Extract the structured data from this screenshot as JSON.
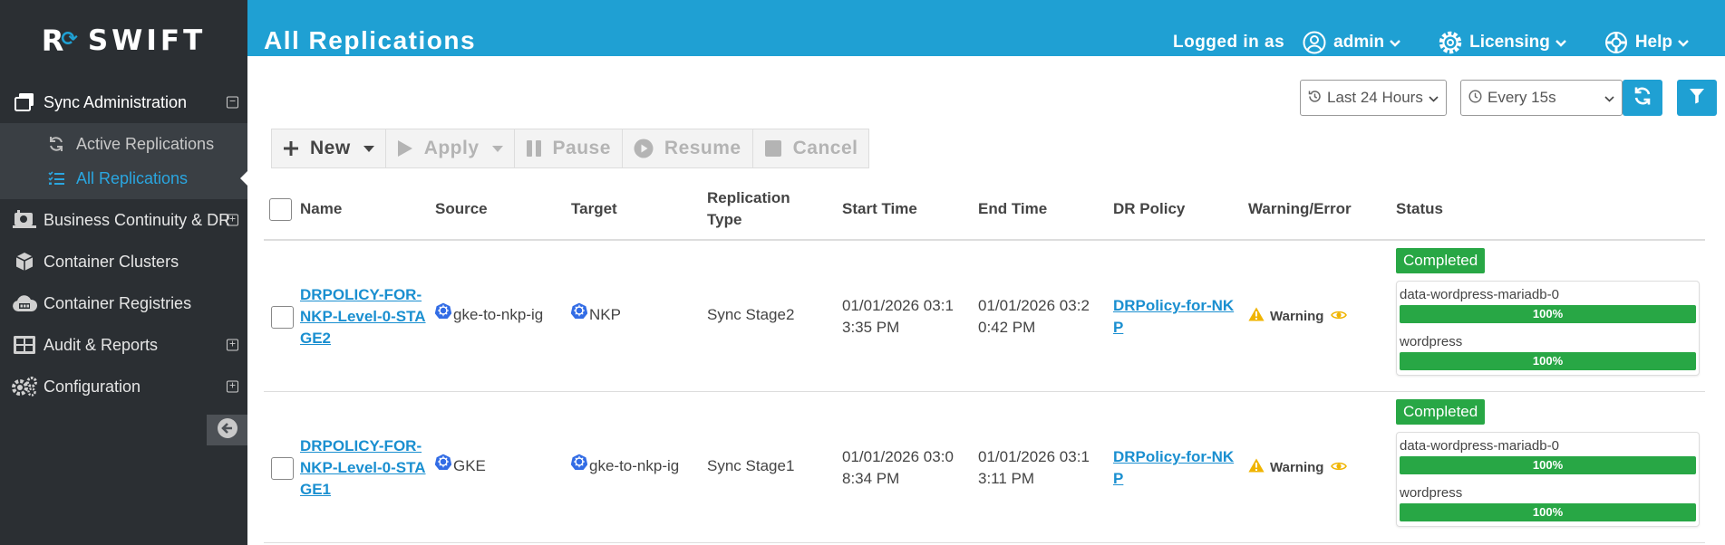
{
  "brand": {
    "logo_letter": "R",
    "name": "SWIFT"
  },
  "sidebar": {
    "items": [
      {
        "label": "Sync Administration",
        "icon": "copy-icon",
        "expander": "−"
      },
      {
        "label": "Business Continuity & DR",
        "icon": "disaster-recovery-icon",
        "expander": "+"
      },
      {
        "label": "Container Clusters",
        "icon": "cube-icon"
      },
      {
        "label": "Container Registries",
        "icon": "cloud-icon"
      },
      {
        "label": "Audit & Reports",
        "icon": "table-icon",
        "expander": "+"
      },
      {
        "label": "Configuration",
        "icon": "gears-icon",
        "expander": "+"
      }
    ],
    "sub_items": [
      {
        "label": "Active Replications",
        "icon": "sync-icon"
      },
      {
        "label": "All Replications",
        "icon": "list-icon",
        "active": true
      }
    ]
  },
  "header": {
    "title": "All Replications",
    "logged_in_label": "Logged in as",
    "user": "admin",
    "licensing": "Licensing",
    "help": "Help"
  },
  "filters": {
    "time_range": "Last 24 Hours",
    "refresh_interval": "Every 15s"
  },
  "toolbar": {
    "new": "New",
    "apply": "Apply",
    "pause": "Pause",
    "resume": "Resume",
    "cancel": "Cancel"
  },
  "table": {
    "columns": {
      "name": "Name",
      "source": "Source",
      "target": "Target",
      "replication_type_1": "Replication",
      "replication_type_2": "Type",
      "start_time": "Start Time",
      "end_time": "End Time",
      "dr_policy": "DR Policy",
      "warning_error": "Warning/Error",
      "status": "Status"
    },
    "rows": [
      {
        "name_l1": "DRPOLICY-FOR-",
        "name_l2": "NKP-Level-0-STA",
        "name_l3": "GE2",
        "source": "gke-to-nkp-ig",
        "target": "NKP",
        "replication_type": "Sync Stage2",
        "start_l1": "01/01/2026 03:1",
        "start_l2": "3:35 PM",
        "end_l1": "01/01/2026 03:2",
        "end_l2": "0:42 PM",
        "policy_l1": "DRPolicy-for-NK",
        "policy_l2": "P",
        "warning": "Warning",
        "status": "Completed",
        "progress": [
          {
            "label": "data-wordpress-mariadb-0",
            "value": 100,
            "text": "100%"
          },
          {
            "label": "wordpress",
            "value": 100,
            "text": "100%"
          }
        ]
      },
      {
        "name_l1": "DRPOLICY-FOR-",
        "name_l2": "NKP-Level-0-STA",
        "name_l3": "GE1",
        "source": "GKE",
        "target": "gke-to-nkp-ig",
        "replication_type": "Sync Stage1",
        "start_l1": "01/01/2026 03:0",
        "start_l2": "8:34 PM",
        "end_l1": "01/01/2026 03:1",
        "end_l2": "3:11 PM",
        "policy_l1": "DRPolicy-for-NK",
        "policy_l2": "P",
        "warning": "Warning",
        "status": "Completed",
        "progress": [
          {
            "label": "data-wordpress-mariadb-0",
            "value": 100,
            "text": "100%"
          },
          {
            "label": "wordpress",
            "value": 100,
            "text": "100%"
          }
        ]
      }
    ]
  },
  "colors": {
    "brand_blue": "#1fa0d3",
    "sidebar_bg": "#2b2f33",
    "success_green": "#28a745",
    "warning_yellow": "#f0b400",
    "link_blue": "#1a8fd0"
  }
}
